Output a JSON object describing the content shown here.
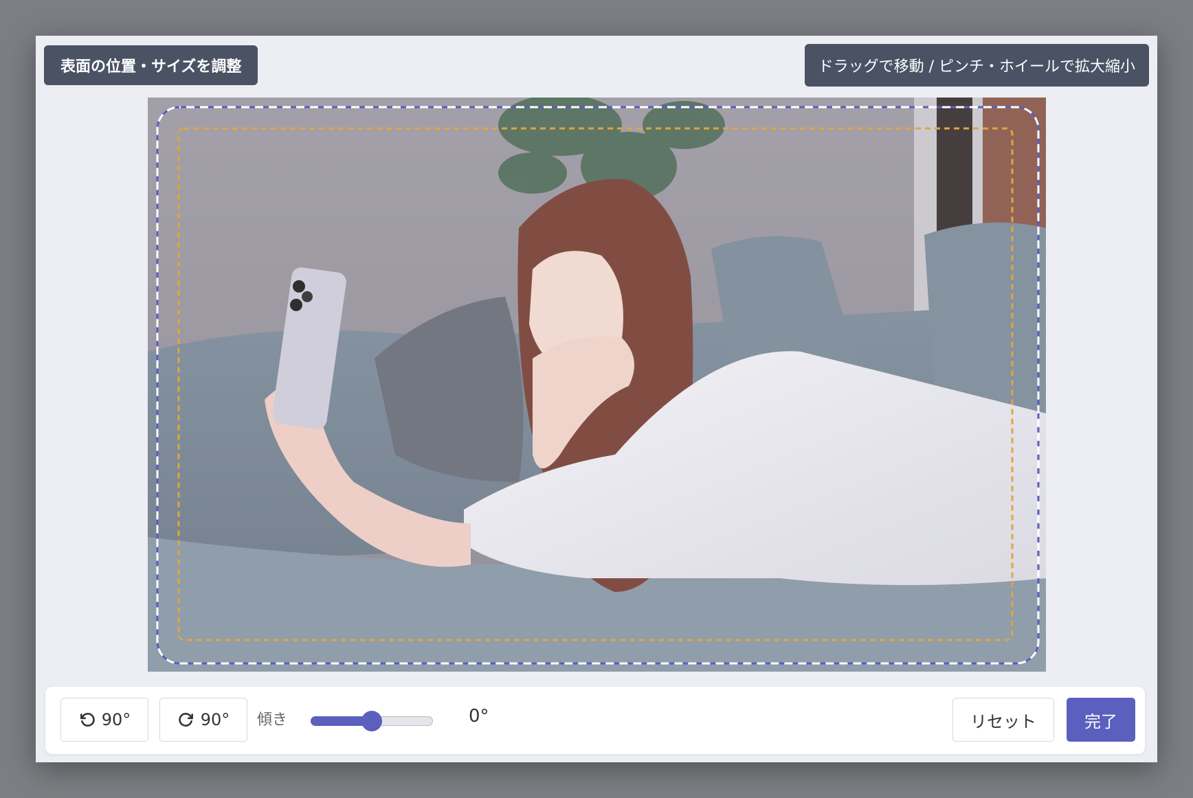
{
  "header": {
    "title": "表面の位置・サイズを調整",
    "hint": "ドラッグで移動 / ピンチ・ホイールで拡大縮小"
  },
  "toolbar": {
    "rotate_left_label": "90°",
    "rotate_right_label": "90°",
    "tilt_label": "傾き",
    "tilt_value": "0°",
    "tilt_slider_fraction": 0.5,
    "reset_label": "リセット",
    "done_label": "完了"
  },
  "guides": {
    "outer_color": "#5b5fbe",
    "inner_color": "#e0a640"
  },
  "colors": {
    "accent": "#5b5fbe",
    "badge_bg": "#4a5264"
  }
}
